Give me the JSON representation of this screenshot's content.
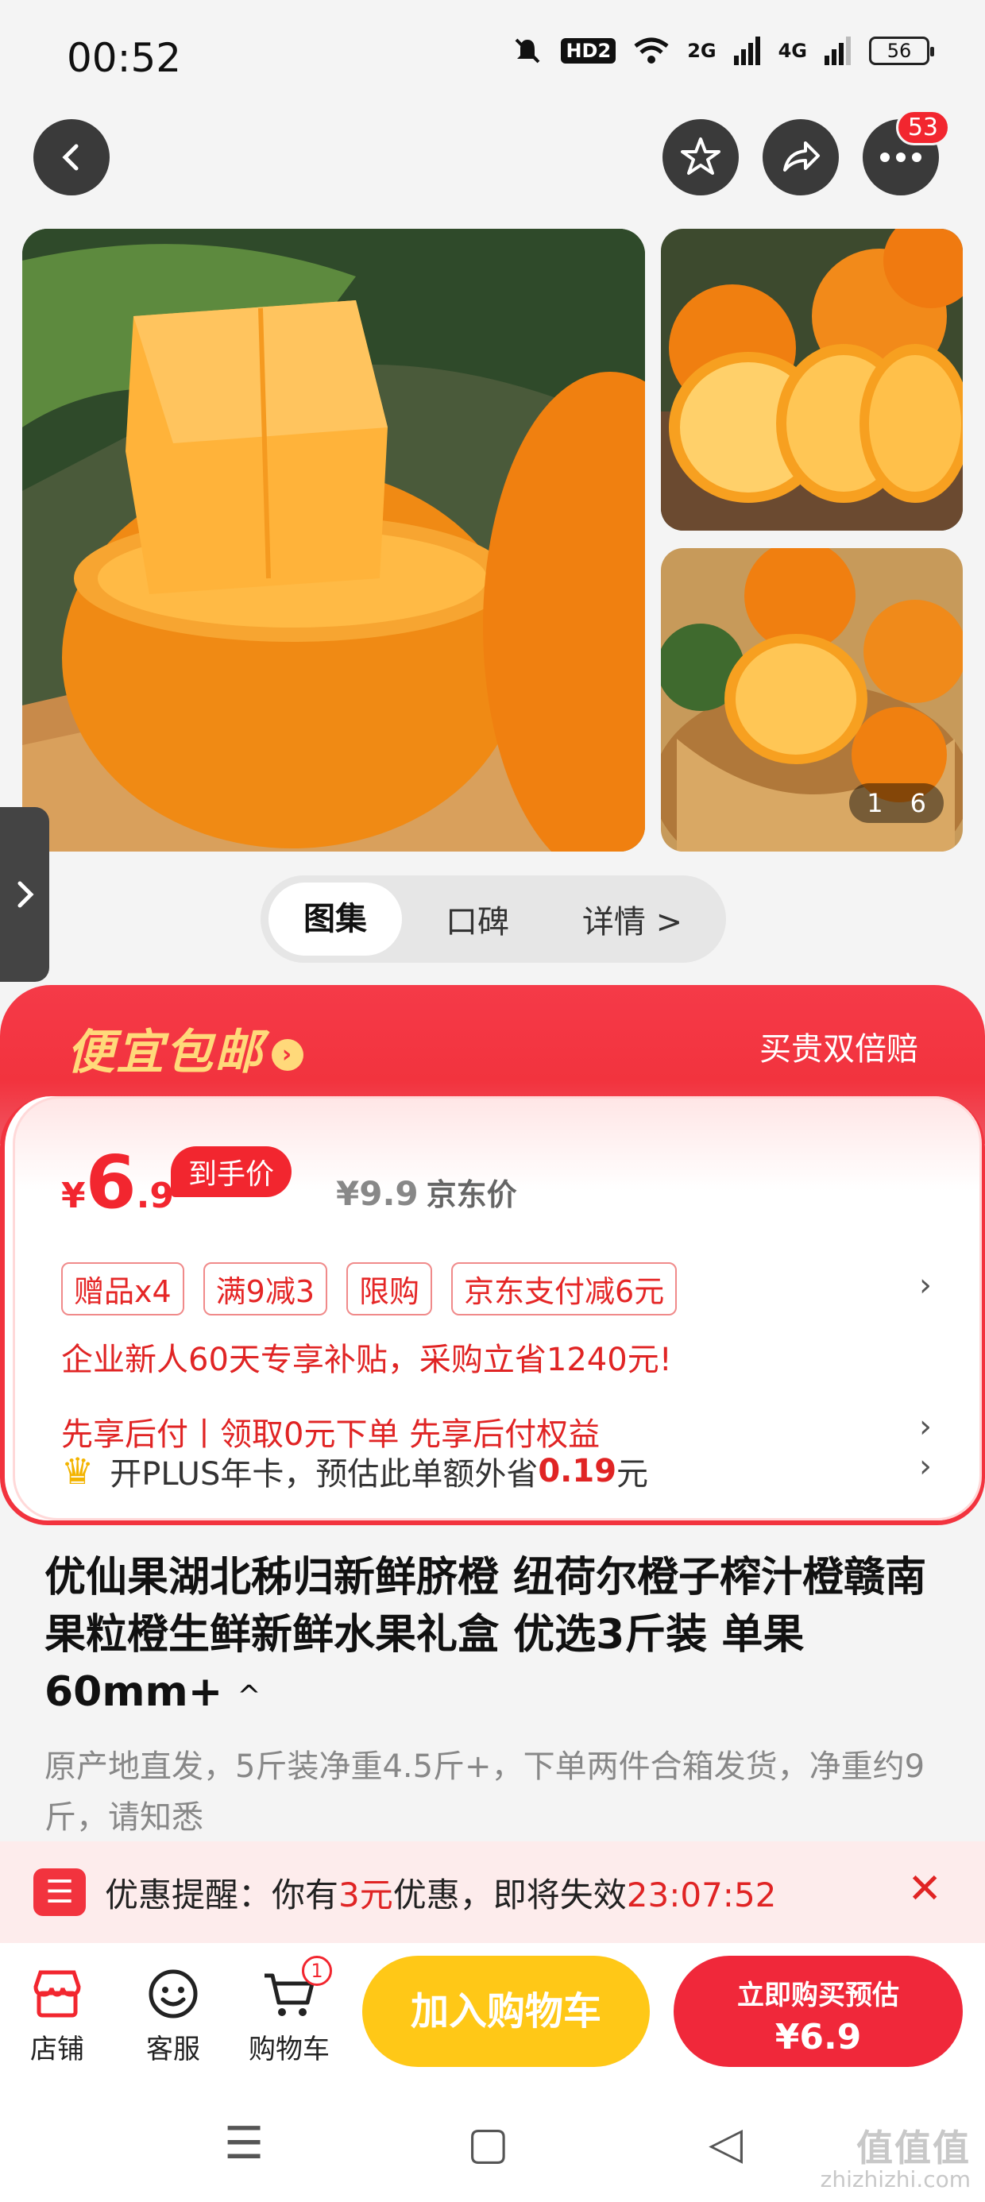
{
  "status_bar": {
    "time": "00:52",
    "hd_label": "HD2",
    "net_1": "2G",
    "net_2": "4G",
    "battery": "56"
  },
  "nav": {
    "more_badge": "53"
  },
  "gallery": {
    "page_current": "1",
    "page_total": "6"
  },
  "tabs": [
    "图集",
    "口碑",
    "详情 >"
  ],
  "promo": {
    "title": "便宜包邮",
    "right_text": "买贵双倍赔",
    "price_yen": "¥",
    "price_int": "6",
    "price_dec": ".9",
    "price_pill": "到手价",
    "orig_price": "¥9.9",
    "orig_label": "京东价",
    "tags": [
      "赠品x4",
      "满9减3",
      "限购",
      "京东支付减6元"
    ],
    "enterprise_line": "企业新人60天专享补贴，采购立省1240元!",
    "pay_later_line": "先享后付丨领取0元下单 先享后付权益",
    "plus_prefix": "开PLUS年卡，预估此单额外省",
    "plus_amount": "0.19",
    "plus_suffix": "元"
  },
  "product": {
    "title": "优仙果湖北秭归新鲜脐橙 纽荷尔橙子榨汁橙赣南果粒橙生鲜新鲜水果礼盒 优选3斤装 单果60mm+",
    "title_caret": "^",
    "desc": "原产地直发，5斤装净重4.5斤+，下单两件合箱发货，净重约9斤，请知悉"
  },
  "reminder": {
    "prefix": "优惠提醒：你有",
    "count": "3元",
    "middle": "优惠，即将失效",
    "countdown": "23:07:52"
  },
  "bottom_bar": {
    "shop": "店铺",
    "service": "客服",
    "cart": "购物车",
    "cart_badge": "1",
    "add_to_cart": "加入购物车",
    "buy_line1": "立即购买预估",
    "buy_line2": "¥6.9"
  },
  "watermark": {
    "big": "值值值",
    "small": "zhizhizhi.com"
  },
  "colors": {
    "accent_red": "#f2262f",
    "cart_yellow": "#ffc817",
    "promo_gold": "#ffd97a"
  }
}
